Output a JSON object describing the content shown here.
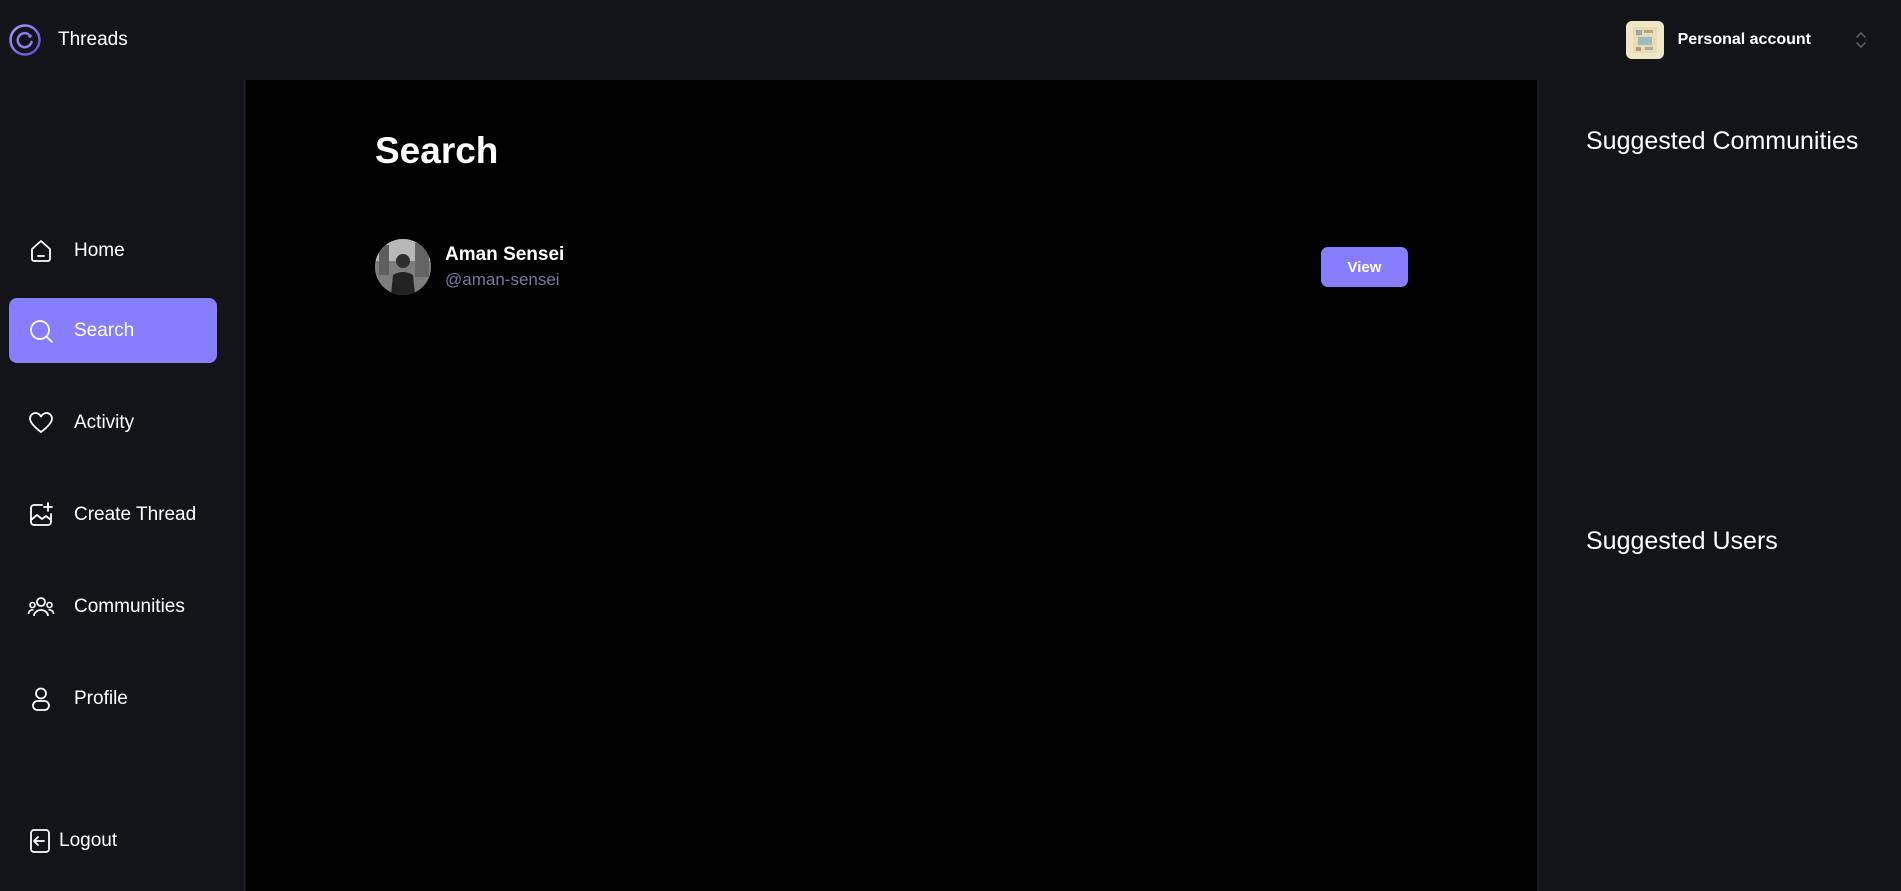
{
  "app": {
    "name": "Threads"
  },
  "account": {
    "label": "Personal account"
  },
  "sidebar": {
    "items": [
      {
        "label": "Home",
        "icon": "home-icon"
      },
      {
        "label": "Search",
        "icon": "search-icon",
        "active": true
      },
      {
        "label": "Activity",
        "icon": "heart-icon"
      },
      {
        "label": "Create Thread",
        "icon": "create-thread-icon"
      },
      {
        "label": "Communities",
        "icon": "communities-icon"
      },
      {
        "label": "Profile",
        "icon": "user-icon"
      }
    ],
    "logout_label": "Logout"
  },
  "main": {
    "title": "Search",
    "results": [
      {
        "name": "Aman Sensei",
        "handle": "@aman-sensei",
        "button": "View"
      }
    ]
  },
  "rightbar": {
    "communities_heading": "Suggested Communities",
    "users_heading": "Suggested Users"
  },
  "colors": {
    "accent": "#877eff",
    "background": "#121417",
    "main_background": "#000000",
    "muted_text": "#7878a3"
  }
}
